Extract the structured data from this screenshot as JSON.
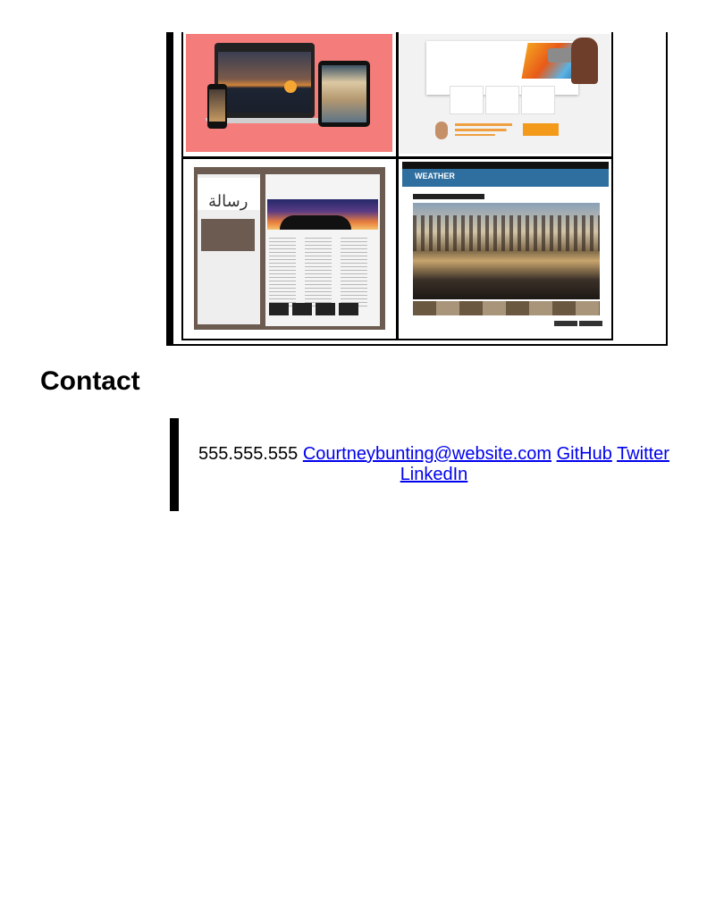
{
  "portfolio": {
    "thumbnails": [
      {
        "name": "device-mockup-thumbnail"
      },
      {
        "name": "telus-landing-thumbnail"
      },
      {
        "name": "arabic-calligraphy-site-thumbnail",
        "script_glyph": "رسالة"
      },
      {
        "name": "bbc-weather-thumbnail",
        "banner": "WEATHER",
        "headline": "Your February images"
      }
    ]
  },
  "contact": {
    "heading": "Contact",
    "phone": "555.555.555",
    "email_link": "Courtneybunting@website.com",
    "github_link": "GitHub",
    "twitter_link": "Twitter",
    "linkedin_link": "LinkedIn"
  },
  "colors": {
    "link": "#0000ee",
    "pink_bg": "#f47c7a",
    "bbc_blue": "#2f6f9f"
  }
}
